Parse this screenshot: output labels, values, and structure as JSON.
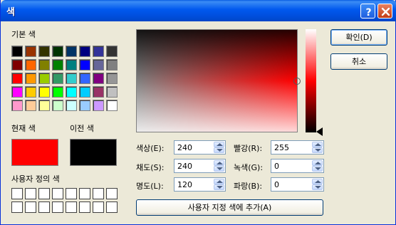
{
  "window": {
    "title": "색"
  },
  "labels": {
    "basic_colors": "기본 색",
    "current_color": "현재 색",
    "previous_color": "이전 색",
    "custom_colors": "사용자 정의 색"
  },
  "colors": {
    "current": "#ff0000",
    "previous": "#000000",
    "basic": [
      [
        "#000000",
        "#993300",
        "#333300",
        "#003300",
        "#003366",
        "#000080",
        "#333399",
        "#333333"
      ],
      [
        "#800000",
        "#ff6600",
        "#808000",
        "#008000",
        "#008080",
        "#0000ff",
        "#666699",
        "#808080"
      ],
      [
        "#ff0000",
        "#ff9900",
        "#99cc00",
        "#339966",
        "#33cccc",
        "#3366ff",
        "#800080",
        "#969696"
      ],
      [
        "#ff00ff",
        "#ffcc00",
        "#ffff00",
        "#00ff00",
        "#00ffff",
        "#00ccff",
        "#993366",
        "#c0c0c0"
      ],
      [
        "#ff99cc",
        "#ffcc99",
        "#ffff99",
        "#ccffcc",
        "#ccffff",
        "#99ccff",
        "#cc99ff",
        "#ffffff"
      ]
    ]
  },
  "fields": {
    "hue": {
      "label": "색상(E):",
      "value": "240"
    },
    "saturation": {
      "label": "채도(S):",
      "value": "240"
    },
    "luminance": {
      "label": "명도(L):",
      "value": "120"
    },
    "red": {
      "label": "빨강(R):",
      "value": "255"
    },
    "green": {
      "label": "녹색(G):",
      "value": "0"
    },
    "blue": {
      "label": "파랑(B):",
      "value": "0"
    }
  },
  "buttons": {
    "ok": "확인(D)",
    "cancel": "취소",
    "add_custom": "사용자 지정 색에 추가(A)"
  }
}
